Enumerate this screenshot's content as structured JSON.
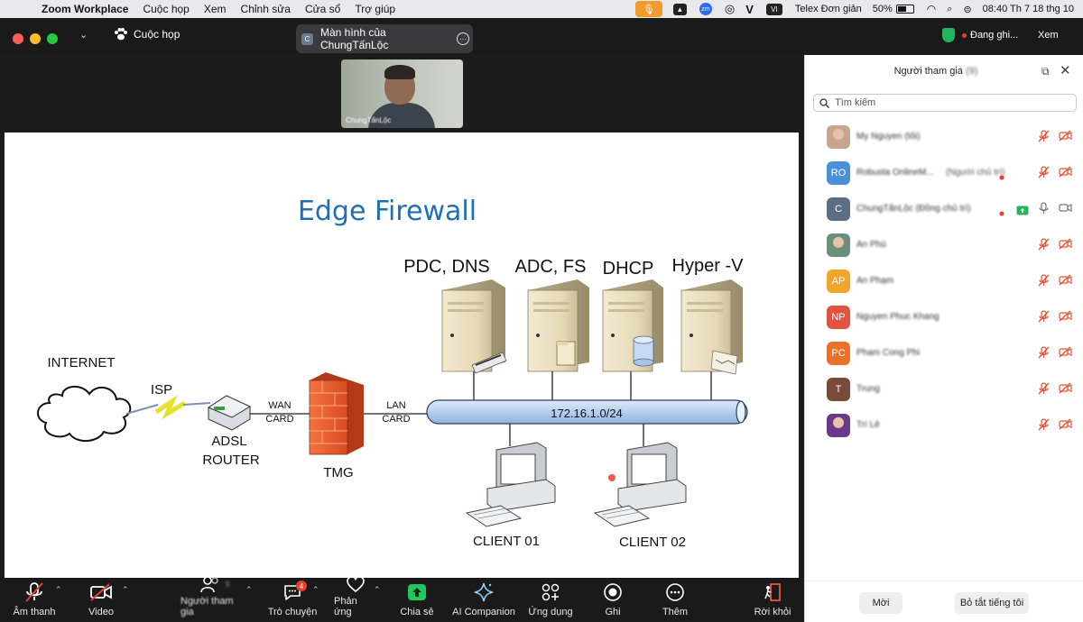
{
  "menubar": {
    "app_name": "Zoom Workplace",
    "items": [
      "Cuộc họp",
      "Xem",
      "Chỉnh sửa",
      "Cửa sổ",
      "Trợ giúp"
    ],
    "vi_label": "VI",
    "input_method": "Telex Đơn giản",
    "battery": "50%",
    "clock": "08:40 Th 7 18 thg 10"
  },
  "topbar": {
    "meeting_label": "Cuộc họp",
    "share_tab_badge": "C",
    "share_tab_title": "Màn hình của ChungTấnLộc",
    "recording_label": "Đang ghi...",
    "view_label": "Xem"
  },
  "video_thumb": {
    "name": "ChungTấnLộc"
  },
  "slide": {
    "title": "Edge Firewall",
    "servers": [
      "PDC, DNS",
      "ADC, FS",
      "DHCP",
      "Hyper -V"
    ],
    "internet": "INTERNET",
    "isp": "ISP",
    "router_l1": "ADSL",
    "router_l2": "ROUTER",
    "wan_l1": "WAN",
    "wan_l2": "CARD",
    "firewall": "TMG",
    "lan_l1": "LAN",
    "lan_l2": "CARD",
    "network": "172.16.1.0/24",
    "client1": "CLIENT 01",
    "client2": "CLIENT 02",
    "colors": {
      "title": "#1f6fb5",
      "bus": "#c6dbf3",
      "firewall": "#e8562e"
    }
  },
  "toolbar": {
    "audio": "Âm thanh",
    "video": "Video",
    "participants": "Người tham gia",
    "participants_count": "9",
    "chat": "Trò chuyện",
    "chat_badge": "4",
    "reactions": "Phản ứng",
    "share": "Chia sẻ",
    "ai": "AI Companion",
    "apps": "Ứng dụng",
    "record": "Ghi",
    "more": "Thêm",
    "leave": "Rời khỏi"
  },
  "panel": {
    "title": "Người tham gia",
    "count": "(9)",
    "search_placeholder": "Tìm kiếm",
    "participants": [
      {
        "initials": "",
        "name": "My Nguyen (tôi)",
        "role": "",
        "color": "#c9a48f",
        "photo": true
      },
      {
        "initials": "RO",
        "name": "Robusta OnlineM...",
        "role": "(Người chủ trì)",
        "color": "#4a90d9"
      },
      {
        "initials": "C",
        "name": "ChungTấnLộc (Đồng chủ trì)",
        "role": "",
        "color": "#5c6f82"
      },
      {
        "initials": "",
        "name": "An Phú",
        "role": "",
        "color": "#6a8f7a",
        "photo": true
      },
      {
        "initials": "AP",
        "name": "An Phạm",
        "role": "",
        "color": "#f0a62a"
      },
      {
        "initials": "NP",
        "name": "Nguyen Phuc Khang",
        "role": "",
        "color": "#e0533f"
      },
      {
        "initials": "PC",
        "name": "Pham Cong Phi",
        "role": "",
        "color": "#e8722a"
      },
      {
        "initials": "T",
        "name": "Trung",
        "role": "",
        "color": "#7a4a3a"
      },
      {
        "initials": "",
        "name": "Trí Lê",
        "role": "",
        "color": "#6a3a8a",
        "photo": true
      }
    ],
    "invite": "Mời",
    "mute_all": "Bỏ tắt tiếng tôi"
  }
}
